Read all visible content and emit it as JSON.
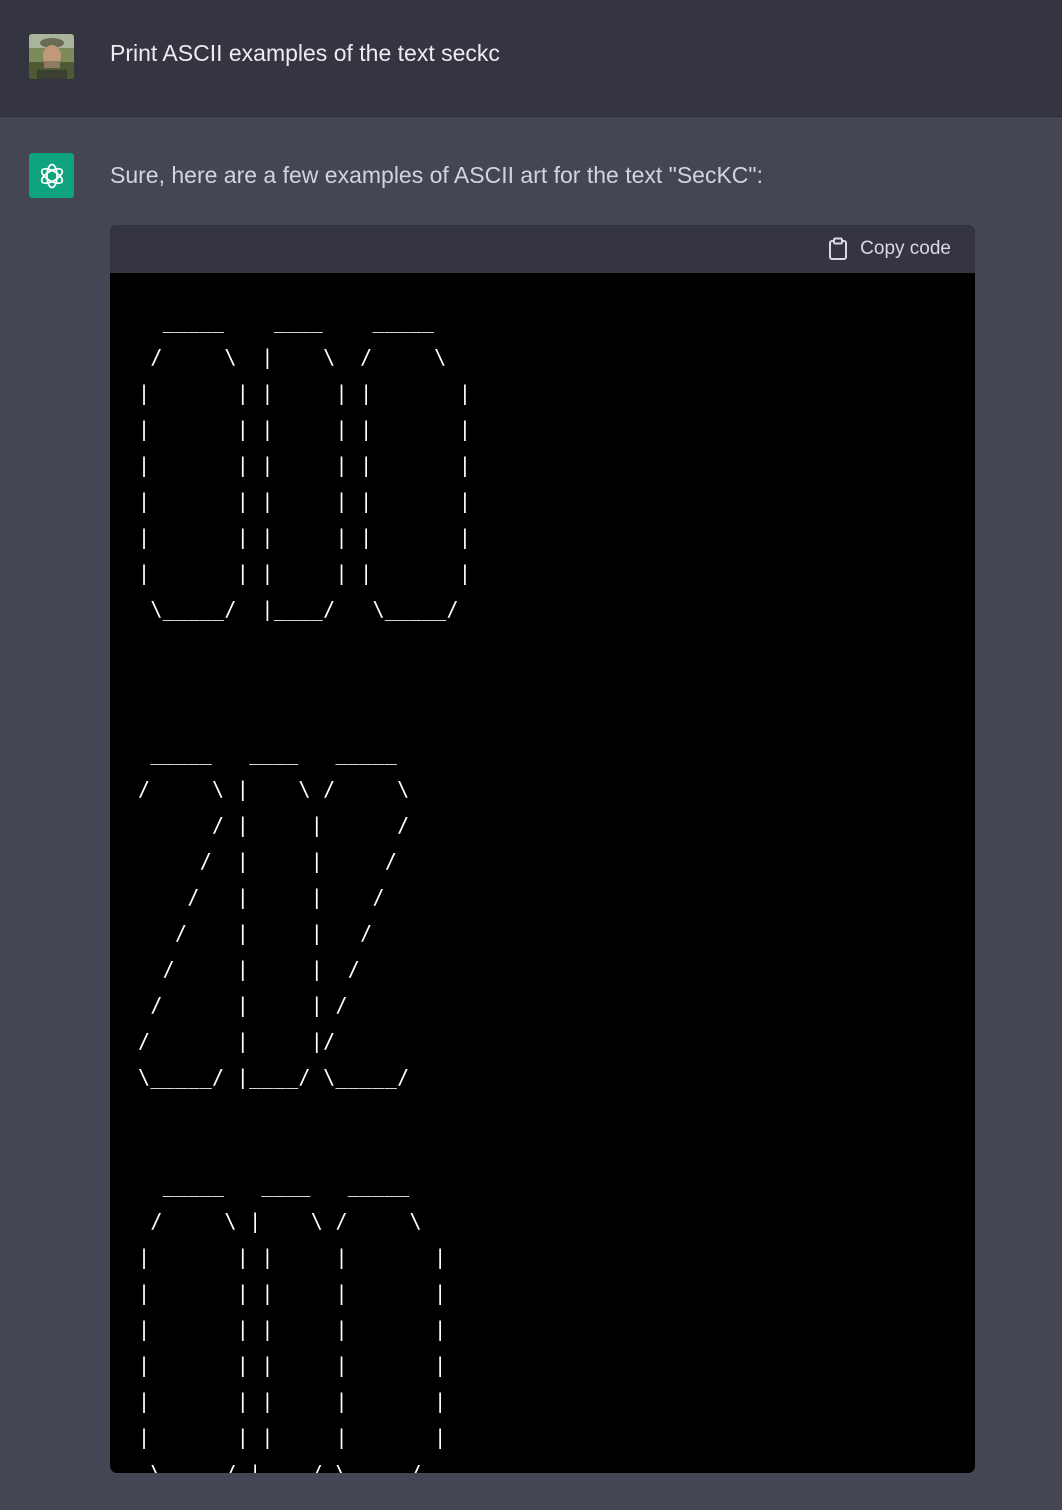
{
  "user_message": {
    "avatar_icon": "user-photo-avatar",
    "text": "Print ASCII examples of the text seckc"
  },
  "assistant_message": {
    "avatar_icon": "openai-logo-icon",
    "brand_color": "#10a37f",
    "intro": "Sure, here are a few examples of ASCII art for the text \"SecKC\":",
    "code_block": {
      "copy_label": "Copy code",
      "copy_icon": "clipboard-icon",
      "examples": [
        "  _____    ____    _____\n /     \\  |    \\  /     \\\n|       | |     | |       |\n|       | |     | |       |\n|       | |     | |       |\n|       | |     | |       |\n|       | |     | |       |\n|       | |     | |       |\n \\_____/  |____/   \\_____/",
        " _____   ____   _____\n/     \\ |    \\ /     \\\n      / |     |      /\n     /  |     |     /\n    /   |     |    /\n   /    |     |   /\n  /     |     |  /\n /      |     | /\n/       |     |/\n\\_____/ |____/ \\_____/",
        "  _____   ____   _____\n /     \\ |    \\ /     \\\n|       | |     |       |\n|       | |     |       |\n|       | |     |       |\n|       | |     |       |\n|       | |     |       |\n|       | |     |       |\n \\_____/ |____/ \\_____/"
      ]
    }
  }
}
